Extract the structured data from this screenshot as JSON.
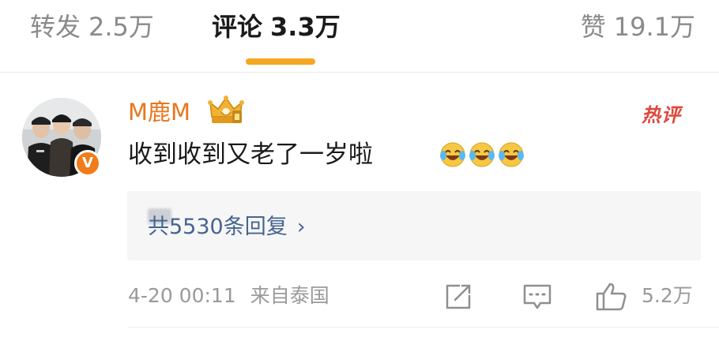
{
  "tabs": [
    {
      "label": "转发",
      "count": "2.5万"
    },
    {
      "label": "评论",
      "count": "3.3万"
    },
    {
      "label": "赞",
      "count": "19.1万"
    }
  ],
  "comment": {
    "username": "M鹿M",
    "badge": "V",
    "hot_label": "热评",
    "text": "收到收到又老了一岁啦",
    "emoji_count": 3,
    "replies_label": "共5530条回复",
    "replies_chevron": "›",
    "timestamp": "4-20 00:11",
    "source": "来自泰国",
    "like_count": "5.2万"
  },
  "colors": {
    "accent": "#f5a623",
    "username": "#e8761e",
    "hot": "#e0463b",
    "link": "#45658f",
    "muted": "#9a9a9a"
  },
  "icons": {
    "share": "share-icon",
    "reply": "comment-icon",
    "like": "thumbs-up-icon",
    "crown": "crown-badge-icon",
    "emoji": "laugh-cry-emoji-icon"
  }
}
